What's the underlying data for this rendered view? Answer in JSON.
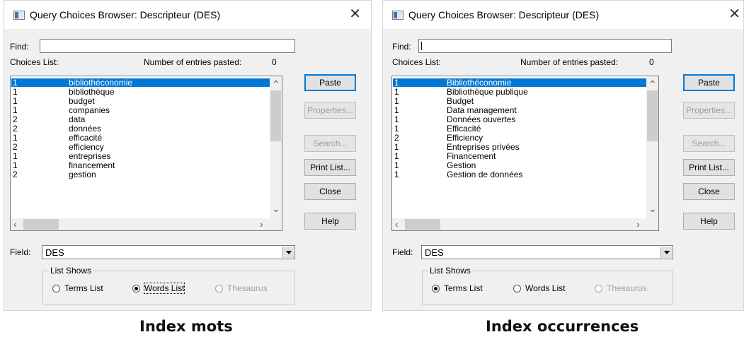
{
  "dialogs": {
    "left": {
      "title": "Query Choices Browser: Descripteur (DES)",
      "find_label": "Find:",
      "find_value": "",
      "choices_label": "Choices List:",
      "entries_label": "Number of entries pasted:",
      "entries_count": "0",
      "rows": [
        {
          "count": "1",
          "term": "bibliothéconomie"
        },
        {
          "count": "1",
          "term": "bibliothèque"
        },
        {
          "count": "1",
          "term": "budget"
        },
        {
          "count": "1",
          "term": "companies"
        },
        {
          "count": "2",
          "term": "data"
        },
        {
          "count": "2",
          "term": "données"
        },
        {
          "count": "1",
          "term": "efficacité"
        },
        {
          "count": "2",
          "term": "efficiency"
        },
        {
          "count": "1",
          "term": "entreprises"
        },
        {
          "count": "1",
          "term": "financement"
        },
        {
          "count": "2",
          "term": "gestion"
        }
      ],
      "selected_row": 0,
      "buttons": {
        "paste": "Paste",
        "properties": "Properties...",
        "search": "Search...",
        "print": "Print List...",
        "close": "Close",
        "help": "Help"
      },
      "field_label": "Field:",
      "field_value": "DES",
      "list_shows_label": "List Shows",
      "radios": {
        "terms": "Terms List",
        "words": "Words List",
        "thesaurus": "Thesaurus"
      },
      "selected_radio": "words",
      "caption": "Index mots"
    },
    "right": {
      "title": "Query Choices Browser: Descripteur (DES)",
      "find_label": "Find:",
      "find_value": "",
      "choices_label": "Choices List:",
      "entries_label": "Number of entries pasted:",
      "entries_count": "0",
      "rows": [
        {
          "count": "1",
          "term": "Bibliothéconomie"
        },
        {
          "count": "1",
          "term": "Bibliothèque publique"
        },
        {
          "count": "1",
          "term": "Budget"
        },
        {
          "count": "1",
          "term": "Data management"
        },
        {
          "count": "1",
          "term": "Données ouvertes"
        },
        {
          "count": "1",
          "term": "Efficacité"
        },
        {
          "count": "2",
          "term": "Efficiency"
        },
        {
          "count": "1",
          "term": "Entreprises privées"
        },
        {
          "count": "1",
          "term": "Financement"
        },
        {
          "count": "1",
          "term": "Gestion"
        },
        {
          "count": "1",
          "term": "Gestion de données"
        }
      ],
      "selected_row": 0,
      "buttons": {
        "paste": "Paste",
        "properties": "Properties...",
        "search": "Search...",
        "print": "Print List...",
        "close": "Close",
        "help": "Help"
      },
      "field_label": "Field:",
      "field_value": "DES",
      "list_shows_label": "List Shows",
      "radios": {
        "terms": "Terms List",
        "words": "Words List",
        "thesaurus": "Thesaurus"
      },
      "selected_radio": "terms",
      "caption": "Index occurrences"
    }
  }
}
